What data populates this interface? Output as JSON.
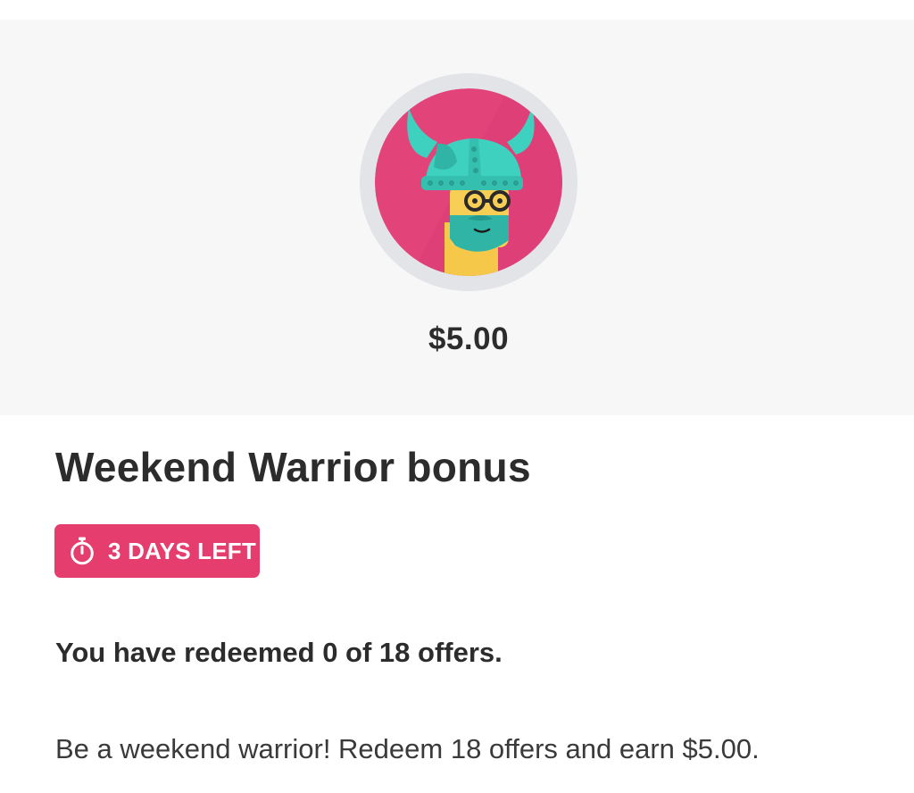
{
  "bonus": {
    "badge_icon": "viking-warrior-icon",
    "reward_amount": "$5.00",
    "title": "Weekend Warrior bonus",
    "time_left_icon": "stopwatch-icon",
    "time_left_label": "3 DAYS LEFT",
    "progress_text": "You have redeemed 0 of 18 offers.",
    "description": "Be a weekend warrior! Redeem 18 offers and earn $5.00."
  },
  "colors": {
    "accent_pink": "#e53e6e",
    "badge_background": "#e2447a",
    "helmet_teal": "#3fd1c0",
    "hero_background": "#f7f7f8",
    "badge_ring": "#e3e4e7"
  }
}
